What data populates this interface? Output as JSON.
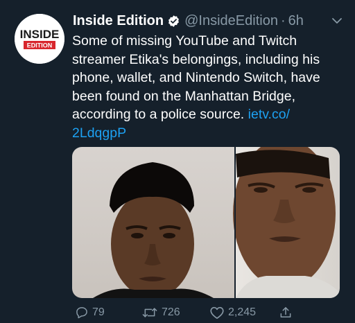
{
  "tweet": {
    "author_name": "Inside Edition",
    "handle": "@InsideEdition",
    "separator": "·",
    "time": "6h",
    "text": "Some of missing YouTube and Twitch streamer Etika's belongings, including his phone, wallet, and Nintendo Switch, have been found on the Manhattan Bridge, according to a police source.",
    "link_text": "ietv.co/​2LdqgpP"
  },
  "avatar": {
    "logo_line1": "INSIDE",
    "logo_line2": "EDITION"
  },
  "media": {
    "left_photo": "face-photo-left",
    "right_photo": "face-photo-right"
  },
  "actions": {
    "replies": "79",
    "retweets": "726",
    "likes": "2,245"
  },
  "icons": [
    "verified-icon",
    "chevron-down-icon",
    "reply-icon",
    "retweet-icon",
    "like-icon",
    "share-icon"
  ],
  "colors": {
    "background": "#15202b",
    "link": "#1da1f2",
    "muted": "#8899a6",
    "logo_red": "#d8262d"
  }
}
